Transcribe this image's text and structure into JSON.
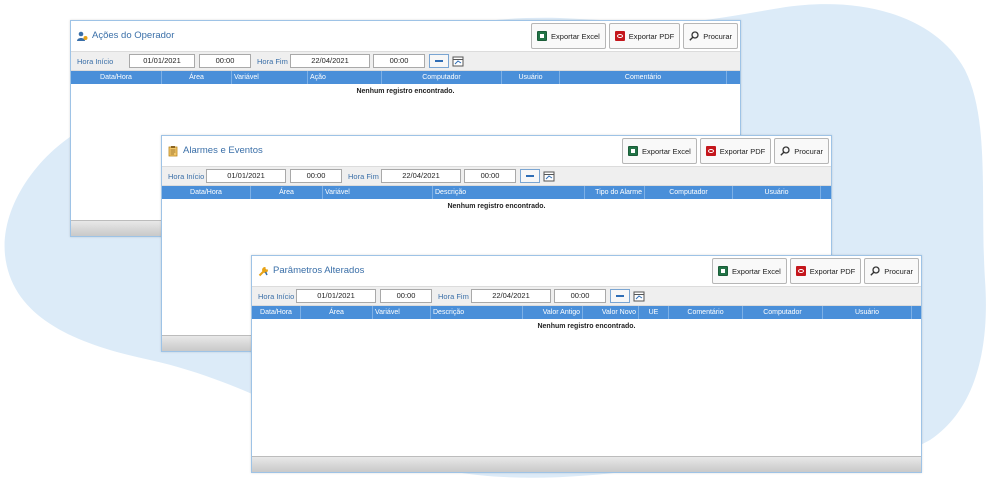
{
  "colors": {
    "accent": "#3a6fa8",
    "header_bg": "#4a8fd9",
    "background_blob": "#dcebf8"
  },
  "panels": [
    {
      "title": "Ações do Operador",
      "icon": "operator-icon",
      "buttons": {
        "excel": "Exportar Excel",
        "pdf": "Exportar PDF",
        "search": "Procurar"
      },
      "filters": {
        "start_label": "Hora Início",
        "start_date": "01/01/2021",
        "start_time": "00:00",
        "end_label": "Hora Fim",
        "end_date": "22/04/2021",
        "end_time": "00:00"
      },
      "columns": [
        "Data/Hora",
        "Área",
        "Variável",
        "Ação",
        "Computador",
        "Usuário",
        "Comentário"
      ],
      "empty_message": "Nenhum registro encontrado."
    },
    {
      "title": "Alarmes e Eventos",
      "icon": "alarm-icon",
      "buttons": {
        "excel": "Exportar Excel",
        "pdf": "Exportar PDF",
        "search": "Procurar"
      },
      "filters": {
        "start_label": "Hora Início",
        "start_date": "01/01/2021",
        "start_time": "00:00",
        "end_label": "Hora Fim",
        "end_date": "22/04/2021",
        "end_time": "00:00"
      },
      "columns": [
        "Data/Hora",
        "Área",
        "Variável",
        "Descrição",
        "Tipo do Alarme",
        "Computador",
        "Usuário"
      ],
      "empty_message": "Nenhum registro encontrado."
    },
    {
      "title": "Parâmetros Alterados",
      "icon": "wrench-icon",
      "buttons": {
        "excel": "Exportar Excel",
        "pdf": "Exportar PDF",
        "search": "Procurar"
      },
      "filters": {
        "start_label": "Hora Início",
        "start_date": "01/01/2021",
        "start_time": "00:00",
        "end_label": "Hora Fim",
        "end_date": "22/04/2021",
        "end_time": "00:00"
      },
      "columns": [
        "Data/Hora",
        "Área",
        "Variável",
        "Descrição",
        "Valor Antigo",
        "Valor Novo",
        "UE",
        "Comentário",
        "Computador",
        "Usuário"
      ],
      "empty_message": "Nenhum registro encontrado."
    }
  ]
}
